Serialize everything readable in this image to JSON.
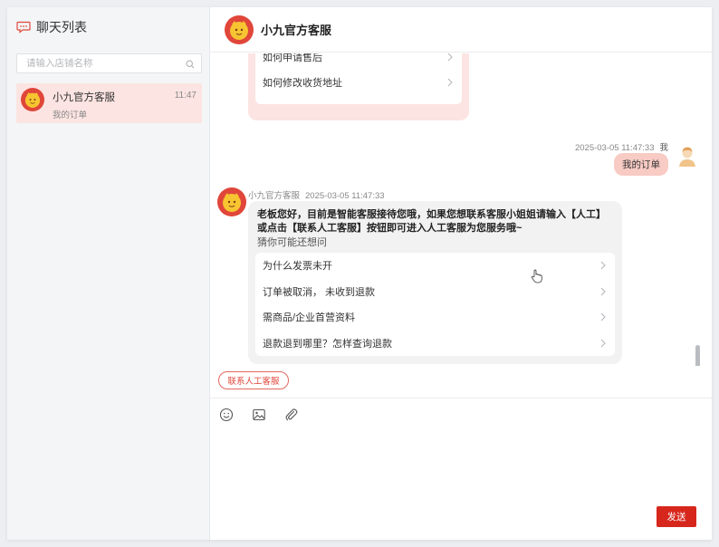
{
  "sidebar": {
    "title": "聊天列表",
    "search_placeholder": "请输入店铺名称",
    "conversations": [
      {
        "name": "小九官方客服",
        "time": "11:47",
        "preview": "我的订单"
      }
    ]
  },
  "chat": {
    "title": "小九官方客服",
    "top_card_options": [
      "如何申请售后",
      "如何修改收货地址"
    ],
    "my_message": {
      "timestamp": "2025-03-05 11:47:33",
      "sender": "我",
      "text": "我的订单"
    },
    "bot_message": {
      "sender": "小九官方客服",
      "timestamp": "2025-03-05 11:47:33",
      "text": "老板您好，目前是智能客服接待您哦，如果您想联系客服小姐姐请输入【人工】或点击【联系人工客服】按钮即可进入人工客服为您服务哦~",
      "subtitle": "猜你可能还想问",
      "options": [
        "为什么发票未开",
        "订单被取消，  未收到退款",
        "需商品/企业首营资料",
        "退款退到哪里？怎样查询退款"
      ]
    },
    "human_agent_button": "联系人工客服",
    "send_button": "发送"
  },
  "colors": {
    "accent": "#d7261c",
    "my_bubble": "#f8cbc4",
    "active_item": "#fbe4e1"
  }
}
